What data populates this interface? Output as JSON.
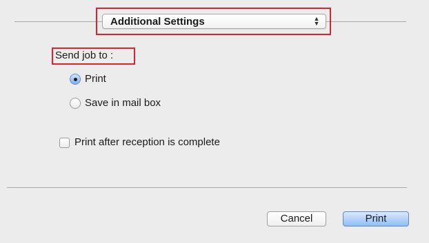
{
  "header": {
    "popup_label": "Additional Settings",
    "popup_icon": "updown-arrows-icon"
  },
  "send_job": {
    "label": "Send job to :",
    "options": [
      {
        "label": "Print",
        "selected": true
      },
      {
        "label": "Save in mail box",
        "selected": false
      }
    ]
  },
  "checkbox": {
    "label": "Print after reception is complete",
    "checked": false
  },
  "footer": {
    "cancel_label": "Cancel",
    "print_label": "Print"
  },
  "colors": {
    "highlight_border": "#e0202b",
    "default_button": "#8fbef5"
  }
}
